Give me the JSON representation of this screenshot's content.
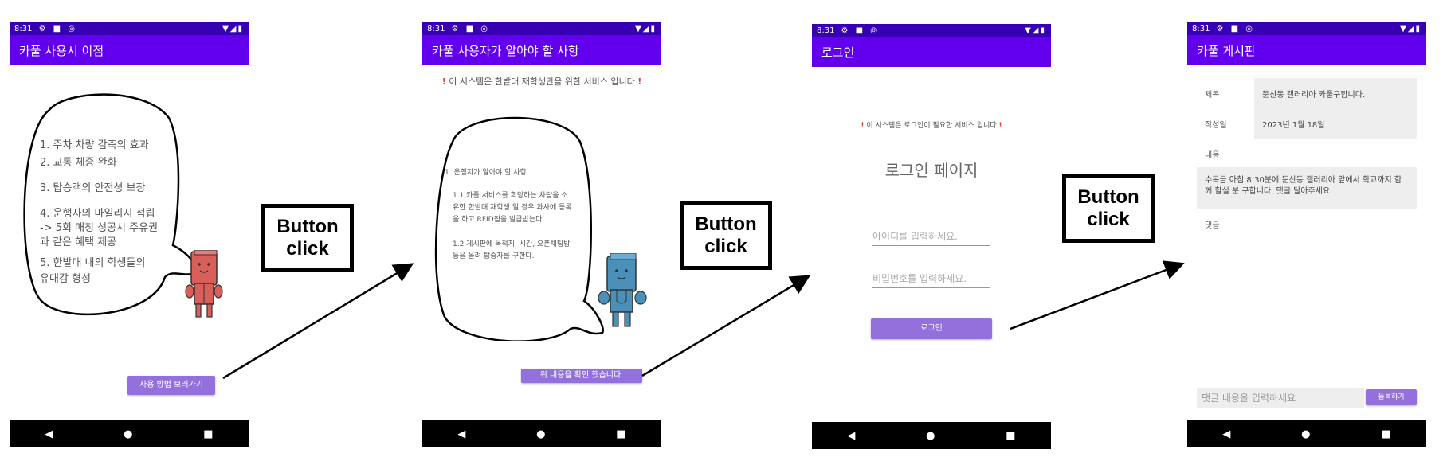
{
  "status": {
    "time": "8:31"
  },
  "screen1": {
    "title": "카풀 사용시 이점",
    "items": [
      "1. 주차 차량 감축의 효과",
      "2. 교통 체증 완화",
      "3. 탑승객의 안전성 보장",
      "4. 운행자의 마일리지 적립",
      "-> 5회 매칭 성공시 주유권",
      "과 같은 혜택 제공",
      "5. 한밭대 내의 학생들의",
      "유대감 형성"
    ],
    "button": "사용 방법 보러가기"
  },
  "screen2": {
    "title": "카풀 사용자가 알아야 할 사항",
    "notice": "이 시스템은 한밭대 재학생만을 위한 서비스 입니다",
    "heading": "1. 운행자가 알아야 할 사항",
    "p1": [
      "1.1 카풀 서비스를 희망하는 차량을 소",
      "유한 한밭대 재학생 일 경우 과사에 등록",
      "을 하고 RFID칩을 발급받는다."
    ],
    "p2": [
      "1.2 게시판에 목적지, 시간, 오픈채팅방",
      "등을 올려 탑승자를 구한다."
    ],
    "button": "위 내용을 확인 했습니다."
  },
  "screen3": {
    "title": "로그인",
    "notice": "이 시스템은 로그인이 필요한 서비스 입니다",
    "heading": "로그인 페이지",
    "id_placeholder": "아이디를 입력하세요.",
    "pw_placeholder": "비밀번호를 입력하세요.",
    "button": "로그인"
  },
  "screen4": {
    "title": "카풀 게시판",
    "subject_label": "제목",
    "subject_value": "둔산동 갤러리아 카풀구합니다.",
    "date_label": "작성일",
    "date_value": "2023년 1월 18일",
    "content_label": "내용",
    "content_value": "수목금 아침 8:30분에 둔산동 갤러리아 앞에서 학교까지 함께 할실 분 구합니다. 댓글 달아주세요.",
    "comment_label": "댓글",
    "comment_placeholder": "댓글 내용을 입력하세요",
    "submit": "등록하기"
  },
  "annotation": {
    "label_line1": "Button",
    "label_line2": "click"
  },
  "colors": {
    "status_bar": "#3700b3",
    "app_bar": "#6200ee",
    "button": "#9370db",
    "robot1": "#d9605a",
    "robot2": "#4a90b8"
  },
  "icons": {
    "nav": [
      "back-icon",
      "home-icon",
      "recents-icon"
    ]
  }
}
